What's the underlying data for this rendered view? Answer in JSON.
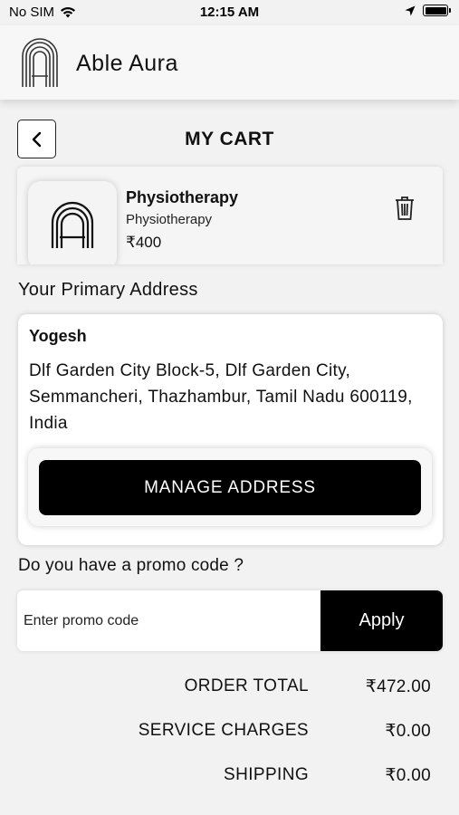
{
  "status_bar": {
    "carrier": "No SIM",
    "time": "12:15 AM",
    "icons": [
      "wifi-icon",
      "location-arrow-icon",
      "battery-icon"
    ]
  },
  "header": {
    "app_name": "Able Aura",
    "logo": "able-aura-logo"
  },
  "page": {
    "title": "MY CART",
    "back_icon": "chevron-left-icon"
  },
  "cart": {
    "items": [
      {
        "name": "Physiotherapy",
        "category": "Physiotherapy",
        "price": "₹400",
        "delete_icon": "trash-icon"
      }
    ]
  },
  "address": {
    "heading": "Your Primary Address",
    "name": "Yogesh",
    "line": "Dlf Garden City Block-5, Dlf Garden City, Semmancheri, Thazhambur, Tamil Nadu 600119, India",
    "manage_label": "MANAGE ADDRESS"
  },
  "promo": {
    "question": "Do you have a promo code ?",
    "placeholder": "Enter promo code",
    "apply_label": "Apply"
  },
  "summary": [
    {
      "label": "ORDER TOTAL",
      "value": "₹472.00"
    },
    {
      "label": "SERVICE CHARGES",
      "value": "₹0.00"
    },
    {
      "label": "SHIPPING",
      "value": "₹0.00"
    }
  ],
  "colors": {
    "background": "#f2f2f2",
    "primary_button": "#000000",
    "primary_button_text": "#ffffff",
    "card": "#ffffff"
  }
}
